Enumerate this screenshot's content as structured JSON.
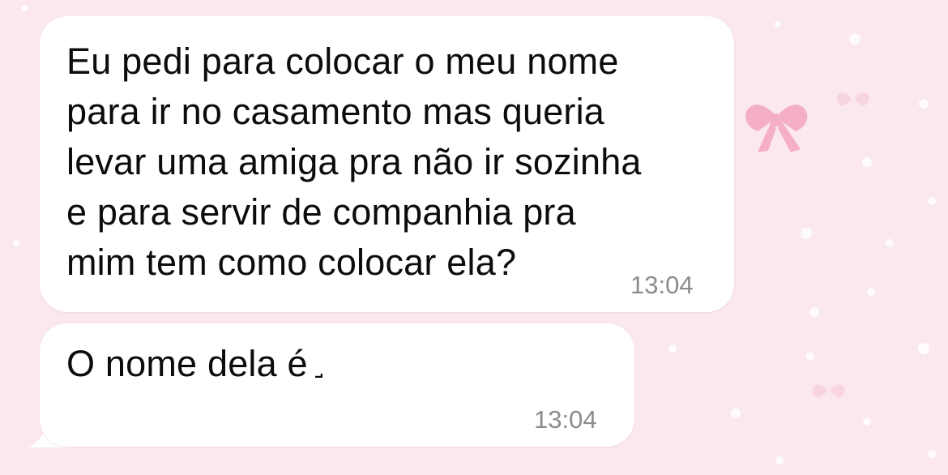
{
  "chat": {
    "background_color": "#fbe7ef",
    "bubble_color": "#ffffff",
    "text_color": "#0c0c0c",
    "time_color": "#8c8c8c",
    "messages": [
      {
        "direction": "incoming",
        "lines": [
          "Eu pedi para colocar o meu nome",
          "para ir no casamento mas queria",
          "levar uma amiga pra não ir sozinha",
          "e para servir de companhia pra",
          "mim tem como colocar ela?"
        ],
        "time": "13:04"
      },
      {
        "direction": "incoming",
        "lines": [
          "O nome dela é"
        ],
        "time": "13:04"
      }
    ]
  }
}
